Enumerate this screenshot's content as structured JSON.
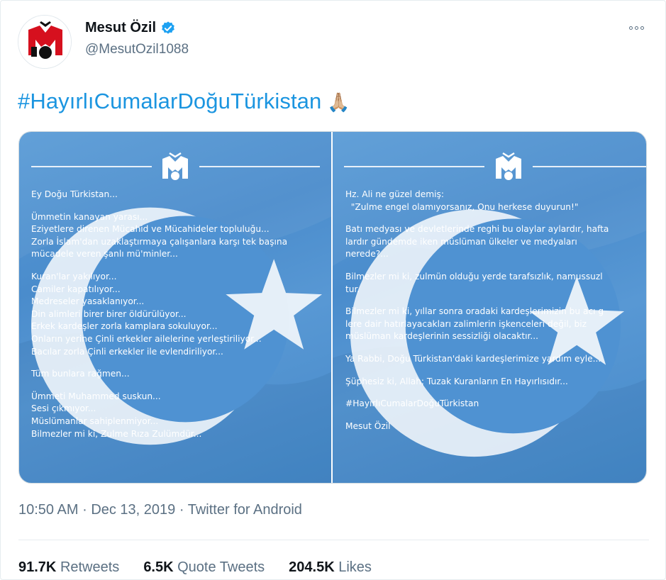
{
  "author": {
    "name": "Mesut Özil",
    "handle": "@MesutOzil1088",
    "verified": true,
    "avatar_icon": "m10-logo-icon"
  },
  "tweet": {
    "text": "#HayırlıCumalarDoğuTürkistan",
    "emoji": "🙏🏼"
  },
  "media": {
    "left_lines": [
      "Ey Doğu Türkistan...",
      "",
      "Ümmetin kanayan yarası...",
      "Eziyetlere direnen Mücahid ve Mücahideler topluluğu...",
      "Zorla İslam'dan uzaklaştırmaya çalışanlara karşı tek başına",
      "mücadele veren şanlı mü'minler...",
      "",
      "Kuran'lar yakılıyor...",
      "Camiler kapatılıyor...",
      "Medreseler yasaklanıyor...",
      "Din alimleri birer birer öldürülüyor...",
      "Erkek kardeşler zorla kamplara sokuluyor...",
      "Onların yerine Çinli erkekler ailelerine yerleştiriliyor...",
      "Bacılar zorla Çinli erkekler ile evlendiriliyor...",
      "",
      "Tüm bunlara rağmen...",
      "",
      "Ümmeti Muhammed suskun...",
      "Sesi çıkmıyor...",
      "Müslümanlar sahiplenmiyor...",
      "Bilmezler mi ki, Zulme Rıza Zulümdür..."
    ],
    "right_lines": [
      "Hz. Ali ne güzel demiş:",
      "  \"Zulme engel olamıyorsanız, Onu herkese duyurun!\"",
      "",
      "Batı medyası ve devletlerinde reghi bu olaylar aylardır, hafta",
      "lardır gündemde iken müslüman ülkeler ve medyaları",
      "nerede?...",
      "",
      "Bilmezler mi ki, zulmün olduğu yerde tarafsızlık, namussuzl",
      "tur.",
      "",
      "Bilmezler mi ki, yıllar sonra oradaki kardeşlerimizin bu acı g",
      "lere dair hatırlayacakları zalimlerin işkenceleri değil, biz",
      "müslüman kardeşlerinin sessizliği olacaktır...",
      "",
      "Ya Rabbi, Doğu Türkistan'daki kardeşlerimize yardım eyle...",
      "",
      "Şüphesiz ki, Allah; Tuzak Kuranların En Hayırlısıdır...",
      "",
      "#HayırlıCumalarDoğuTürkistan",
      "",
      "Mesut Özil"
    ]
  },
  "meta": {
    "time": "10:50 AM",
    "dot1": "·",
    "date": "Dec 13, 2019",
    "dot2": "·",
    "source": "Twitter for Android"
  },
  "stats": {
    "retweets_count": "91.7K",
    "retweets_label": "Retweets",
    "quotes_count": "6.5K",
    "quotes_label": "Quote Tweets",
    "likes_count": "204.5K",
    "likes_label": "Likes"
  },
  "colors": {
    "link": "#1b95e0",
    "secondary": "#5b7083",
    "flag_blue": "#4f92d2",
    "verified": "#1da1f2"
  }
}
